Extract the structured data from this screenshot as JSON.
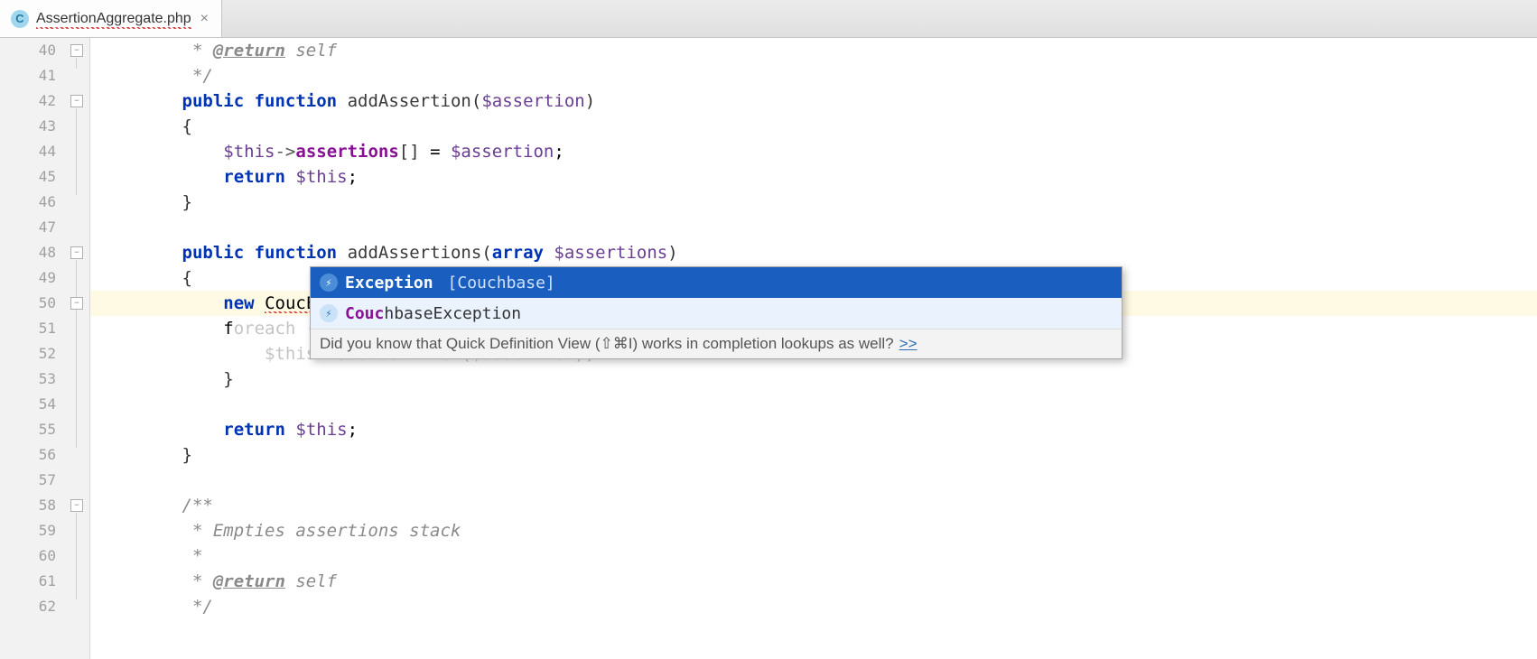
{
  "tab": {
    "icon_letter": "C",
    "filename": "AssertionAggregate.php",
    "close_glyph": "×"
  },
  "line_numbers": [
    "40",
    "41",
    "42",
    "43",
    "44",
    "45",
    "46",
    "47",
    "48",
    "49",
    "50",
    "51",
    "52",
    "53",
    "54",
    "55",
    "56",
    "57",
    "58",
    "59",
    "60",
    "61",
    "62"
  ],
  "code": {
    "l40_pre": "         * ",
    "l40_tag": "@return",
    "l40_post": " self",
    "l41": "         */",
    "l42_indent": "        ",
    "l42_public": "public",
    "l42_function": "function",
    "l42_name": "addAssertion",
    "l42_paren_open": "(",
    "l42_param": "$assertion",
    "l42_paren_close": ")",
    "l43_indent": "        ",
    "l43_brace": "{",
    "l44_indent": "            ",
    "l44_this": "$this",
    "l44_arrow": "->",
    "l44_prop": "assertions",
    "l44_brackets": "[]",
    "l44_eq": " = ",
    "l44_var": "$assertion",
    "l44_semi": ";",
    "l45_indent": "            ",
    "l45_return": "return",
    "l45_sp": " ",
    "l45_this": "$this",
    "l45_semi": ";",
    "l46_indent": "        ",
    "l46_brace": "}",
    "l47": "",
    "l48_indent": "        ",
    "l48_public": "public",
    "l48_function": "function",
    "l48_name": "addAssertions",
    "l48_paren_open": "(",
    "l48_array": "array",
    "l48_sp": " ",
    "l48_param": "$assertions",
    "l48_paren_close": ")",
    "l49_indent": "        ",
    "l49_brace": "{",
    "l50_indent": "            ",
    "l50_new": "new",
    "l50_sp": " ",
    "l50_typed": "CoucE",
    "l51_indent": "            ",
    "l51_f": "f",
    "l51_ghost": "oreach ($assertions as $assertion) {",
    "l52_ghost": "                $this->addAssertion($assertion);",
    "l53_indent": "            ",
    "l53_brace": "}",
    "l54": "",
    "l55_indent": "            ",
    "l55_return": "return",
    "l55_sp": " ",
    "l55_this": "$this",
    "l55_semi": ";",
    "l56_indent": "        ",
    "l56_brace": "}",
    "l57": "",
    "l58_indent": "        ",
    "l58_comment": "/**",
    "l59_indent": "         ",
    "l59_comment": "* Empties assertions stack",
    "l60_indent": "         ",
    "l60_comment": "*",
    "l61_indent": "         ",
    "l61_star": "* ",
    "l61_tag": "@return",
    "l61_post": " self",
    "l62_indent": "         ",
    "l62_comment": "*/"
  },
  "completion": {
    "items": [
      {
        "icon_glyph": "⚡",
        "main": "Exception",
        "context": "[Couchbase]",
        "selected": true
      },
      {
        "icon_glyph": "⚡",
        "match_prefix": "Couc",
        "match_rest": "hbaseException",
        "selected": false
      }
    ],
    "hint_text": "Did you know that Quick Definition View (⇧⌘I) works in completion lookups as well?",
    "hint_link": ">>"
  }
}
